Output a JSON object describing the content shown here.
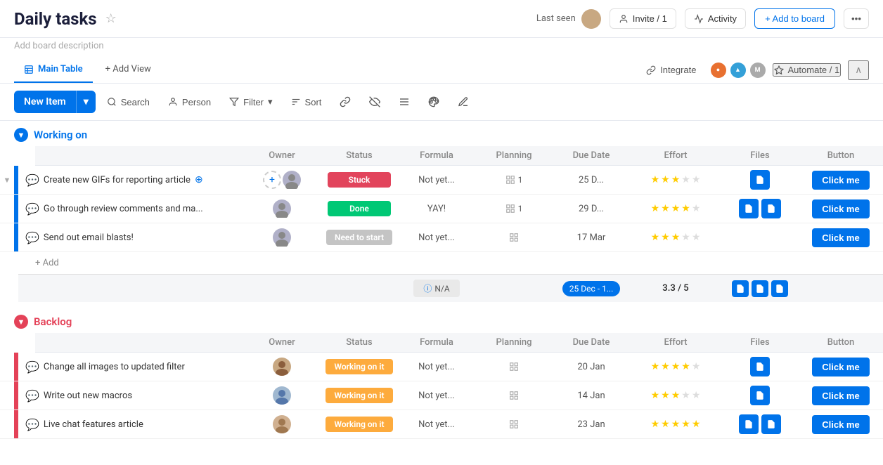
{
  "header": {
    "title": "Daily tasks",
    "last_seen_label": "Last seen",
    "invite_label": "Invite / 1",
    "activity_label": "Activity",
    "add_board_label": "+ Add to board",
    "board_desc": "Add board description"
  },
  "views": {
    "main_table": "Main Table",
    "add_view": "+ Add View",
    "integrate": "Integrate",
    "automate": "Automate / 1"
  },
  "toolbar": {
    "new_item": "New Item",
    "search": "Search",
    "person": "Person",
    "filter": "Filter",
    "sort": "Sort"
  },
  "groups": [
    {
      "name": "Working on",
      "color": "#0073ea",
      "toggle_color": "#0073ea",
      "columns": [
        "Owner",
        "Status",
        "Formula",
        "Planning",
        "Due Date",
        "Effort",
        "Files",
        "Button"
      ],
      "rows": [
        {
          "task": "Create new GIFs for reporting article",
          "owner": "person1",
          "status": "Stuck",
          "status_type": "stuck",
          "formula": "Not yet...",
          "planning": "1",
          "due_date": "25 D...",
          "effort_filled": 3,
          "effort_total": 5,
          "files_count": 1,
          "button_label": "Click me"
        },
        {
          "task": "Go through review comments and ma...",
          "owner": "person2",
          "status": "Done",
          "status_type": "done",
          "formula": "YAY!",
          "planning": "1",
          "due_date": "29 D...",
          "effort_filled": 4,
          "effort_total": 5,
          "files_count": 2,
          "button_label": "Click me"
        },
        {
          "task": "Send out email blasts!",
          "owner": "person3",
          "status": "Need to start",
          "status_type": "need",
          "formula": "Not yet...",
          "planning": "0",
          "due_date": "17 Mar",
          "effort_filled": 3,
          "effort_total": 5,
          "files_count": 0,
          "button_label": "Click me"
        }
      ],
      "summary": {
        "formula_label": "N/A",
        "date_label": "25 Dec - 1...",
        "effort_label": "3.3 / 5",
        "files_count": 3
      }
    },
    {
      "name": "Backlog",
      "color": "#e44258",
      "toggle_color": "#e44258",
      "columns": [
        "Owner",
        "Status",
        "Formula",
        "Planning",
        "Due Date",
        "Effort",
        "Files",
        "Button"
      ],
      "rows": [
        {
          "task": "Change all images to updated filter",
          "owner": "person4",
          "status": "Working on it",
          "status_type": "working",
          "formula": "Not yet...",
          "planning": "0",
          "due_date": "20 Jan",
          "effort_filled": 4,
          "effort_total": 5,
          "files_count": 1,
          "button_label": "Click me"
        },
        {
          "task": "Write out new macros",
          "owner": "person5",
          "status": "Working on it",
          "status_type": "working",
          "formula": "Not yet...",
          "planning": "0",
          "due_date": "14 Jan",
          "effort_filled": 3,
          "effort_total": 5,
          "files_count": 1,
          "button_label": "Click me"
        },
        {
          "task": "Live chat features article",
          "owner": "person6",
          "status": "Working on it",
          "status_type": "working",
          "formula": "Not yet...",
          "planning": "0",
          "due_date": "23 Jan",
          "effort_filled": 5,
          "effort_total": 5,
          "files_count": 2,
          "button_label": "Click me"
        }
      ]
    }
  ]
}
